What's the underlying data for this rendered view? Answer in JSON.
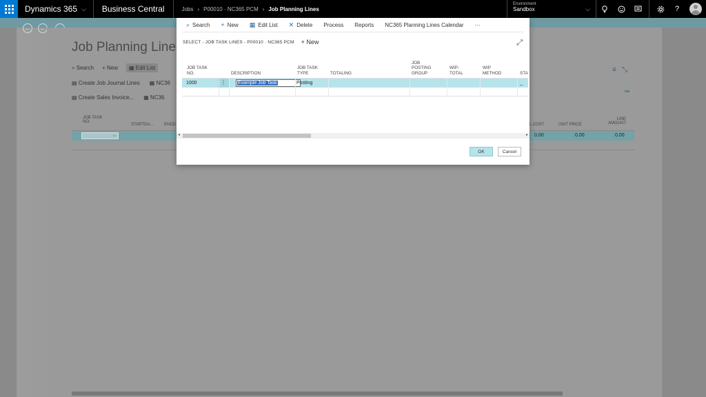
{
  "topbar": {
    "brand": "Dynamics 365",
    "product": "Business Central",
    "breadcrumbs": [
      "Jobs",
      "P00010 · NC365 PCM",
      "Job Planning Lines"
    ],
    "environment_label": "Environment",
    "environment_value": "Sandbox"
  },
  "background_page": {
    "title": "Job Planning Lines",
    "actions": {
      "search": "Search",
      "new": "New",
      "edit_list": "Edit List",
      "nc365": "NC365"
    },
    "row2": {
      "create_job_journal": "Create Job Journal Lines",
      "nc36": "NC36"
    },
    "row3": {
      "create_sales_invoice": "Create Sales Invoice...",
      "nc36": "NC36"
    },
    "headers": {
      "job_task_no": "JOB TASK NO.",
      "startda": "STARTDA...",
      "endd": "ENDD",
      "cost": "L COST",
      "unit_price": "UNIT PRICE",
      "line_amount": "LINE AMOUNT"
    },
    "row_values": {
      "cost": "0.00",
      "unit_price": "0.00",
      "line_amount": "0.00"
    }
  },
  "modal": {
    "toolbar": {
      "search": "Search",
      "new": "New",
      "edit_list": "Edit List",
      "delete": "Delete",
      "process": "Process",
      "reports": "Reports",
      "calendar": "NC365 Planning Lines Calendar",
      "more": "···"
    },
    "caption": "SELECT - JOB TASK LINES - P00010 · NC365 PCM",
    "new_label": "New",
    "columns": {
      "job_task_no": "JOB TASK NO.",
      "description": "DESCRIPTION",
      "job_task_type": "JOB TASK TYPE",
      "totaling": "TOTALING",
      "job_posting_group": "JOB POSTING GROUP",
      "wip_total": "WIP-TOTAL",
      "wip_method": "WIP METHOD",
      "sta": "STA"
    },
    "row": {
      "job_task_no": "1000",
      "description": "Example Job Task",
      "job_task_type": "Posting",
      "sta": "_"
    },
    "ok_label": "OK",
    "cancel_label": "Cancel"
  }
}
